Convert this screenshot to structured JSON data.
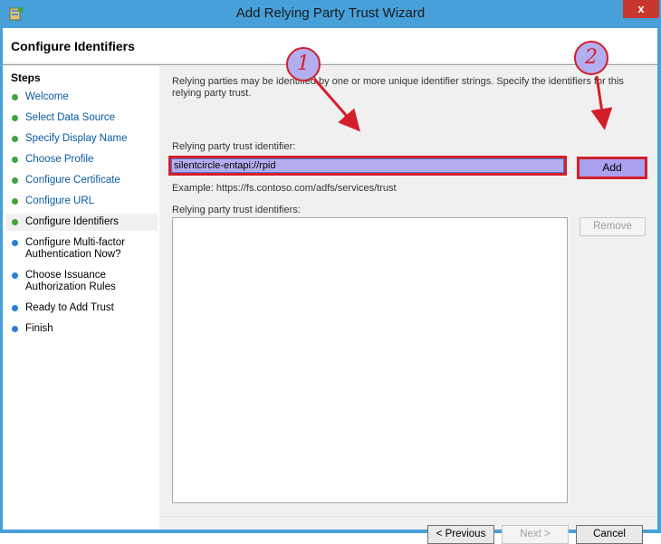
{
  "window": {
    "title": "Add Relying Party Trust Wizard",
    "close_glyph": "x",
    "icon": "server-icon"
  },
  "page": {
    "title": "Configure Identifiers"
  },
  "steps": {
    "title": "Steps",
    "items": [
      {
        "label": "Welcome",
        "status": "done"
      },
      {
        "label": "Select Data Source",
        "status": "done"
      },
      {
        "label": "Specify Display Name",
        "status": "done"
      },
      {
        "label": "Choose Profile",
        "status": "done"
      },
      {
        "label": "Configure Certificate",
        "status": "done"
      },
      {
        "label": "Configure URL",
        "status": "done"
      },
      {
        "label": "Configure Identifiers",
        "status": "current"
      },
      {
        "label": "Configure Multi-factor Authentication Now?",
        "status": "pending"
      },
      {
        "label": "Choose Issuance Authorization Rules",
        "status": "pending"
      },
      {
        "label": "Ready to Add Trust",
        "status": "pending"
      },
      {
        "label": "Finish",
        "status": "pending"
      }
    ]
  },
  "main": {
    "description": "Relying parties may be identified by one or more unique identifier strings. Specify the identifiers for this relying party trust.",
    "identifier_label": "Relying party trust identifier:",
    "identifier_value": "silentcircle-entapi://rpid",
    "add_label": "Add",
    "example": "Example: https://fs.contoso.com/adfs/services/trust",
    "identifiers_label": "Relying party trust identifiers:",
    "remove_label": "Remove"
  },
  "footer": {
    "previous_label": "< Previous",
    "next_label": "Next >",
    "cancel_label": "Cancel"
  },
  "annotations": {
    "one": "1",
    "two": "2",
    "color": "#d31f2a"
  },
  "colors": {
    "titlebar": "#47a0d9",
    "highlight": "#b3aef0",
    "done_dot": "#3fa33f",
    "pending_dot": "#2c7fd3"
  }
}
